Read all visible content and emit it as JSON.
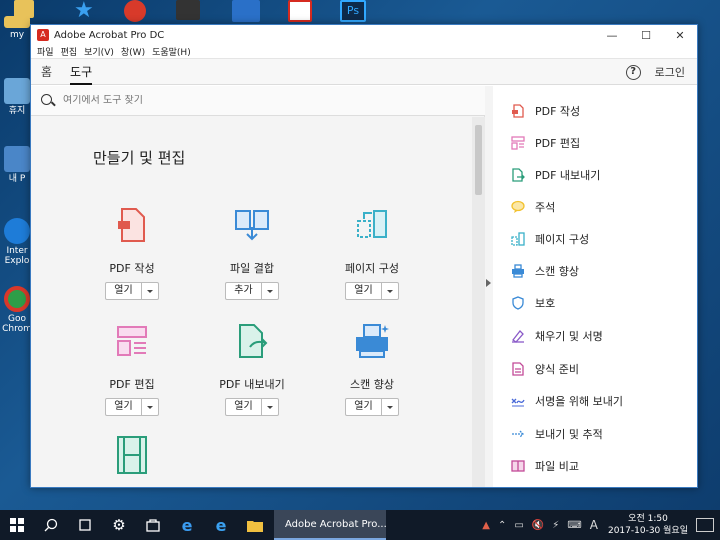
{
  "desktop": {
    "icons": [
      {
        "label": "my",
        "color": "#e8c25a"
      },
      {
        "label": "휴지",
        "color": "#6aa6d8"
      },
      {
        "label": "내 P",
        "color": "#4a86c8"
      },
      {
        "label": "Inter Explo",
        "color": "#1e7cd8"
      },
      {
        "label": "Goo Chrom",
        "color": "#2e9e48"
      }
    ]
  },
  "window": {
    "title": "Adobe Acrobat Pro DC",
    "controls": {
      "minimize": "—",
      "maximize": "☐",
      "close": "✕"
    },
    "menu": [
      "파일",
      "편집",
      "보기(V)",
      "창(W)",
      "도움말(H)"
    ],
    "nav_tabs": [
      "홈",
      "도구"
    ],
    "help": "?",
    "login": "로그인",
    "search_placeholder": "여기에서 도구 찾기",
    "section_title": "만들기 및 편집",
    "tools": [
      {
        "name": "PDF 작성",
        "button": "열기",
        "color": "#e05a4e"
      },
      {
        "name": "파일 결합",
        "button": "추가",
        "color": "#3a8ad6"
      },
      {
        "name": "페이지 구성",
        "button": "열기",
        "color": "#3ab0c8"
      },
      {
        "name": "PDF 편집",
        "button": "열기",
        "color": "#e27ab8"
      },
      {
        "name": "PDF 내보내기",
        "button": "열기",
        "color": "#2a9d7a"
      },
      {
        "name": "스캔 향상",
        "button": "열기",
        "color": "#3a8ad6"
      },
      {
        "name": "",
        "button": "",
        "color": "#2a9d7a"
      }
    ],
    "side_tools": [
      {
        "label": "PDF 작성",
        "color": "#e05a4e"
      },
      {
        "label": "PDF 편집",
        "color": "#e27ab8"
      },
      {
        "label": "PDF 내보내기",
        "color": "#2a9d7a"
      },
      {
        "label": "주석",
        "color": "#f2c230"
      },
      {
        "label": "페이지 구성",
        "color": "#3ab0c8"
      },
      {
        "label": "스캔 향상",
        "color": "#3a8ad6"
      },
      {
        "label": "보호",
        "color": "#3a8ad6"
      },
      {
        "label": "채우기 및 서명",
        "color": "#8a5ac8"
      },
      {
        "label": "양식 준비",
        "color": "#c24a98"
      },
      {
        "label": "서명을 위해 보내기",
        "color": "#4a6ad8"
      },
      {
        "label": "보내기 및 추적",
        "color": "#3a8ad6"
      },
      {
        "label": "파일 비교",
        "color": "#c24a98"
      }
    ]
  },
  "taskbar": {
    "app_label": "Adobe Acrobat Pro...",
    "ime": "A",
    "time": "오전 1:50",
    "date": "2017-10-30 월요일"
  }
}
